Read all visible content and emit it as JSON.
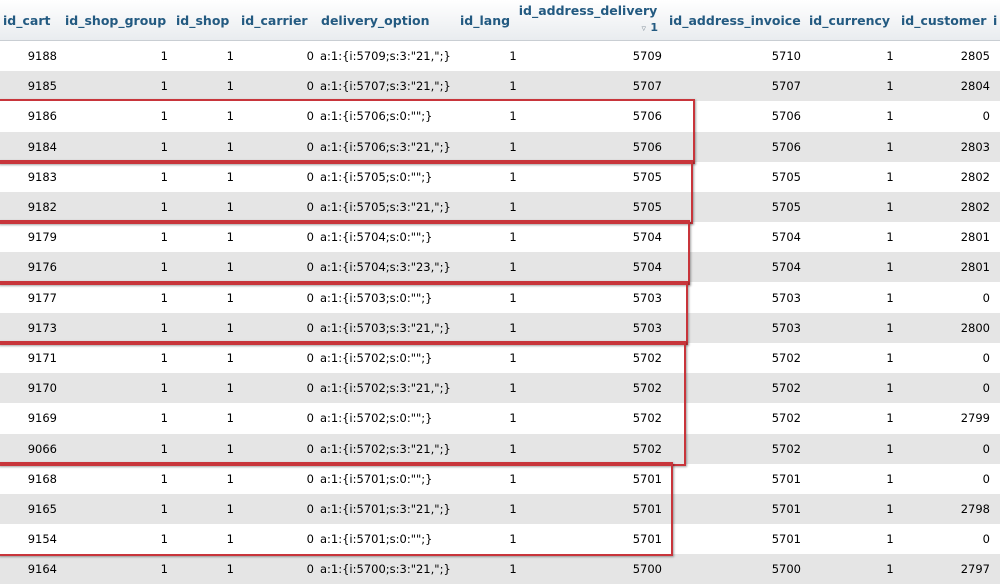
{
  "columns": [
    {
      "key": "id_cart",
      "label": "id_cart"
    },
    {
      "key": "id_shop_group",
      "label": "id_shop_group"
    },
    {
      "key": "id_shop",
      "label": "id_shop"
    },
    {
      "key": "id_carrier",
      "label": "id_carrier"
    },
    {
      "key": "delivery_option",
      "label": "delivery_option"
    },
    {
      "key": "id_lang",
      "label": "id_lang"
    },
    {
      "key": "id_address_delivery",
      "label": "id_address_delivery",
      "sort_indicator": "▿",
      "sort_order": "1"
    },
    {
      "key": "id_address_invoice",
      "label": "id_address_invoice"
    },
    {
      "key": "id_currency",
      "label": "id_currency"
    },
    {
      "key": "id_customer",
      "label": "id_customer"
    },
    {
      "key": "next",
      "label": "i"
    }
  ],
  "rows": [
    [
      "9188",
      "1",
      "1",
      "0",
      "a:1:{i:5709;s:3:\"21,\";}",
      "1",
      "5709",
      "5710",
      "1",
      "2805"
    ],
    [
      "9185",
      "1",
      "1",
      "0",
      "a:1:{i:5707;s:3:\"21,\";}",
      "1",
      "5707",
      "5707",
      "1",
      "2804"
    ],
    [
      "9186",
      "1",
      "1",
      "0",
      "a:1:{i:5706;s:0:\"\";}",
      "1",
      "5706",
      "5706",
      "1",
      "0"
    ],
    [
      "9184",
      "1",
      "1",
      "0",
      "a:1:{i:5706;s:3:\"21,\";}",
      "1",
      "5706",
      "5706",
      "1",
      "2803"
    ],
    [
      "9183",
      "1",
      "1",
      "0",
      "a:1:{i:5705;s:0:\"\";}",
      "1",
      "5705",
      "5705",
      "1",
      "2802"
    ],
    [
      "9182",
      "1",
      "1",
      "0",
      "a:1:{i:5705;s:3:\"21,\";}",
      "1",
      "5705",
      "5705",
      "1",
      "2802"
    ],
    [
      "9179",
      "1",
      "1",
      "0",
      "a:1:{i:5704;s:0:\"\";}",
      "1",
      "5704",
      "5704",
      "1",
      "2801"
    ],
    [
      "9176",
      "1",
      "1",
      "0",
      "a:1:{i:5704;s:3:\"23,\";}",
      "1",
      "5704",
      "5704",
      "1",
      "2801"
    ],
    [
      "9177",
      "1",
      "1",
      "0",
      "a:1:{i:5703;s:0:\"\";}",
      "1",
      "5703",
      "5703",
      "1",
      "0"
    ],
    [
      "9173",
      "1",
      "1",
      "0",
      "a:1:{i:5703;s:3:\"21,\";}",
      "1",
      "5703",
      "5703",
      "1",
      "2800"
    ],
    [
      "9171",
      "1",
      "1",
      "0",
      "a:1:{i:5702;s:0:\"\";}",
      "1",
      "5702",
      "5702",
      "1",
      "0"
    ],
    [
      "9170",
      "1",
      "1",
      "0",
      "a:1:{i:5702;s:3:\"21,\";}",
      "1",
      "5702",
      "5702",
      "1",
      "0"
    ],
    [
      "9169",
      "1",
      "1",
      "0",
      "a:1:{i:5702;s:0:\"\";}",
      "1",
      "5702",
      "5702",
      "1",
      "2799"
    ],
    [
      "9066",
      "1",
      "1",
      "0",
      "a:1:{i:5702;s:3:\"21,\";}",
      "1",
      "5702",
      "5702",
      "1",
      "0"
    ],
    [
      "9168",
      "1",
      "1",
      "0",
      "a:1:{i:5701;s:0:\"\";}",
      "1",
      "5701",
      "5701",
      "1",
      "0"
    ],
    [
      "9165",
      "1",
      "1",
      "0",
      "a:1:{i:5701;s:3:\"21,\";}",
      "1",
      "5701",
      "5701",
      "1",
      "2798"
    ],
    [
      "9154",
      "1",
      "1",
      "0",
      "a:1:{i:5701;s:0:\"\";}",
      "1",
      "5701",
      "5701",
      "1",
      "0"
    ],
    [
      "9164",
      "1",
      "1",
      "0",
      "a:1:{i:5700;s:3:\"21,\";}",
      "1",
      "5700",
      "5700",
      "1",
      "2797"
    ]
  ],
  "highlight_groups": [
    {
      "start": 2,
      "end": 3
    },
    {
      "start": 4,
      "end": 5
    },
    {
      "start": 6,
      "end": 7
    },
    {
      "start": 8,
      "end": 9
    },
    {
      "start": 10,
      "end": 13
    },
    {
      "start": 14,
      "end": 16
    }
  ],
  "colors": {
    "header_text": "#235a81",
    "row_alt": "#e5e5e5",
    "highlight": "#c8353b"
  }
}
